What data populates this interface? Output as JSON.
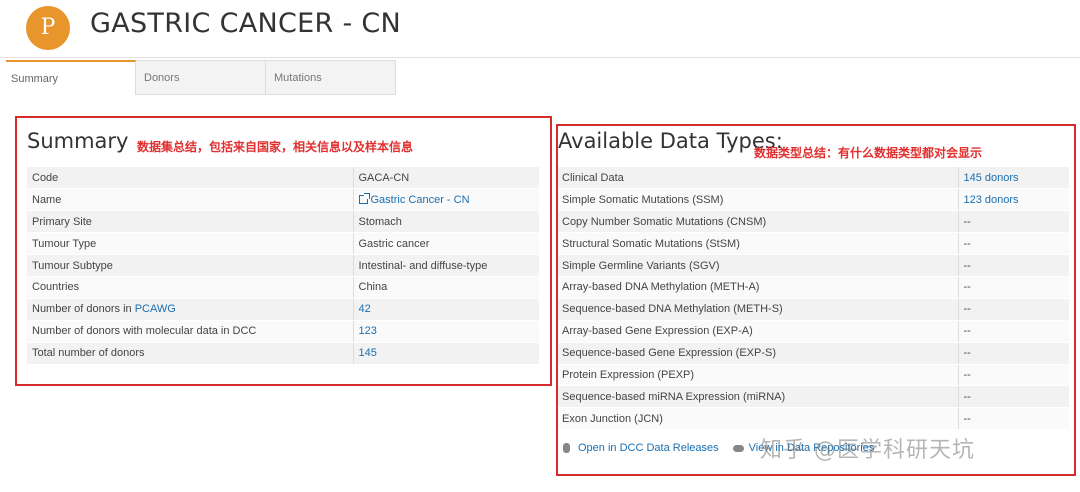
{
  "header": {
    "logo_letter": "P",
    "title": "GASTRIC CANCER - CN"
  },
  "tabs": [
    "Summary",
    "Donors",
    "Mutations"
  ],
  "summary": {
    "title": "Summary",
    "annotation": "数据集总结，包括来自国家，相关信息以及样本信息",
    "rows": [
      {
        "label": "Code",
        "value": "GACA-CN"
      },
      {
        "label": "Name",
        "value": "Gastric Cancer - CN"
      },
      {
        "label": "Primary Site",
        "value": "Stomach"
      },
      {
        "label": "Tumour Type",
        "value": "Gastric cancer"
      },
      {
        "label": "Tumour Subtype",
        "value": "Intestinal- and diffuse-type"
      },
      {
        "label": "Countries",
        "value": "China"
      },
      {
        "label_prefix": "Number of donors in ",
        "label_link": "PCAWG",
        "value": "42"
      },
      {
        "label": "Number of donors with molecular data in DCC",
        "value": "123"
      },
      {
        "label": "Total number of donors",
        "value": "145"
      }
    ]
  },
  "data_types": {
    "title": "Available Data Types:",
    "annotation": "数据类型总结：有什么数据类型都对会显示",
    "rows": [
      {
        "label": "Clinical Data",
        "value": "145 donors"
      },
      {
        "label": "Simple Somatic Mutations (SSM)",
        "value": "123 donors"
      },
      {
        "label": "Copy Number Somatic Mutations (CNSM)",
        "value": "--"
      },
      {
        "label": "Structural Somatic Mutations (StSM)",
        "value": "--"
      },
      {
        "label": "Simple Germline Variants (SGV)",
        "value": "--"
      },
      {
        "label": "Array-based DNA Methylation (METH-A)",
        "value": "--"
      },
      {
        "label": "Sequence-based DNA Methylation (METH-S)",
        "value": "--"
      },
      {
        "label": "Array-based Gene Expression (EXP-A)",
        "value": "--"
      },
      {
        "label": "Sequence-based Gene Expression (EXP-S)",
        "value": "--"
      },
      {
        "label": "Protein Expression (PEXP)",
        "value": "--"
      },
      {
        "label": "Sequence-based miRNA Expression (miRNA)",
        "value": "--"
      },
      {
        "label": "Exon Junction (JCN)",
        "value": "--"
      }
    ],
    "open_dcc_label": "Open in DCC Data Releases",
    "view_repo_label": "View in Data Repositories"
  },
  "watermark": "知乎 @医学科研天坑",
  "colors": {
    "accent": "#e8952c",
    "link": "#1a6fb0",
    "annotation": "#e03030"
  }
}
